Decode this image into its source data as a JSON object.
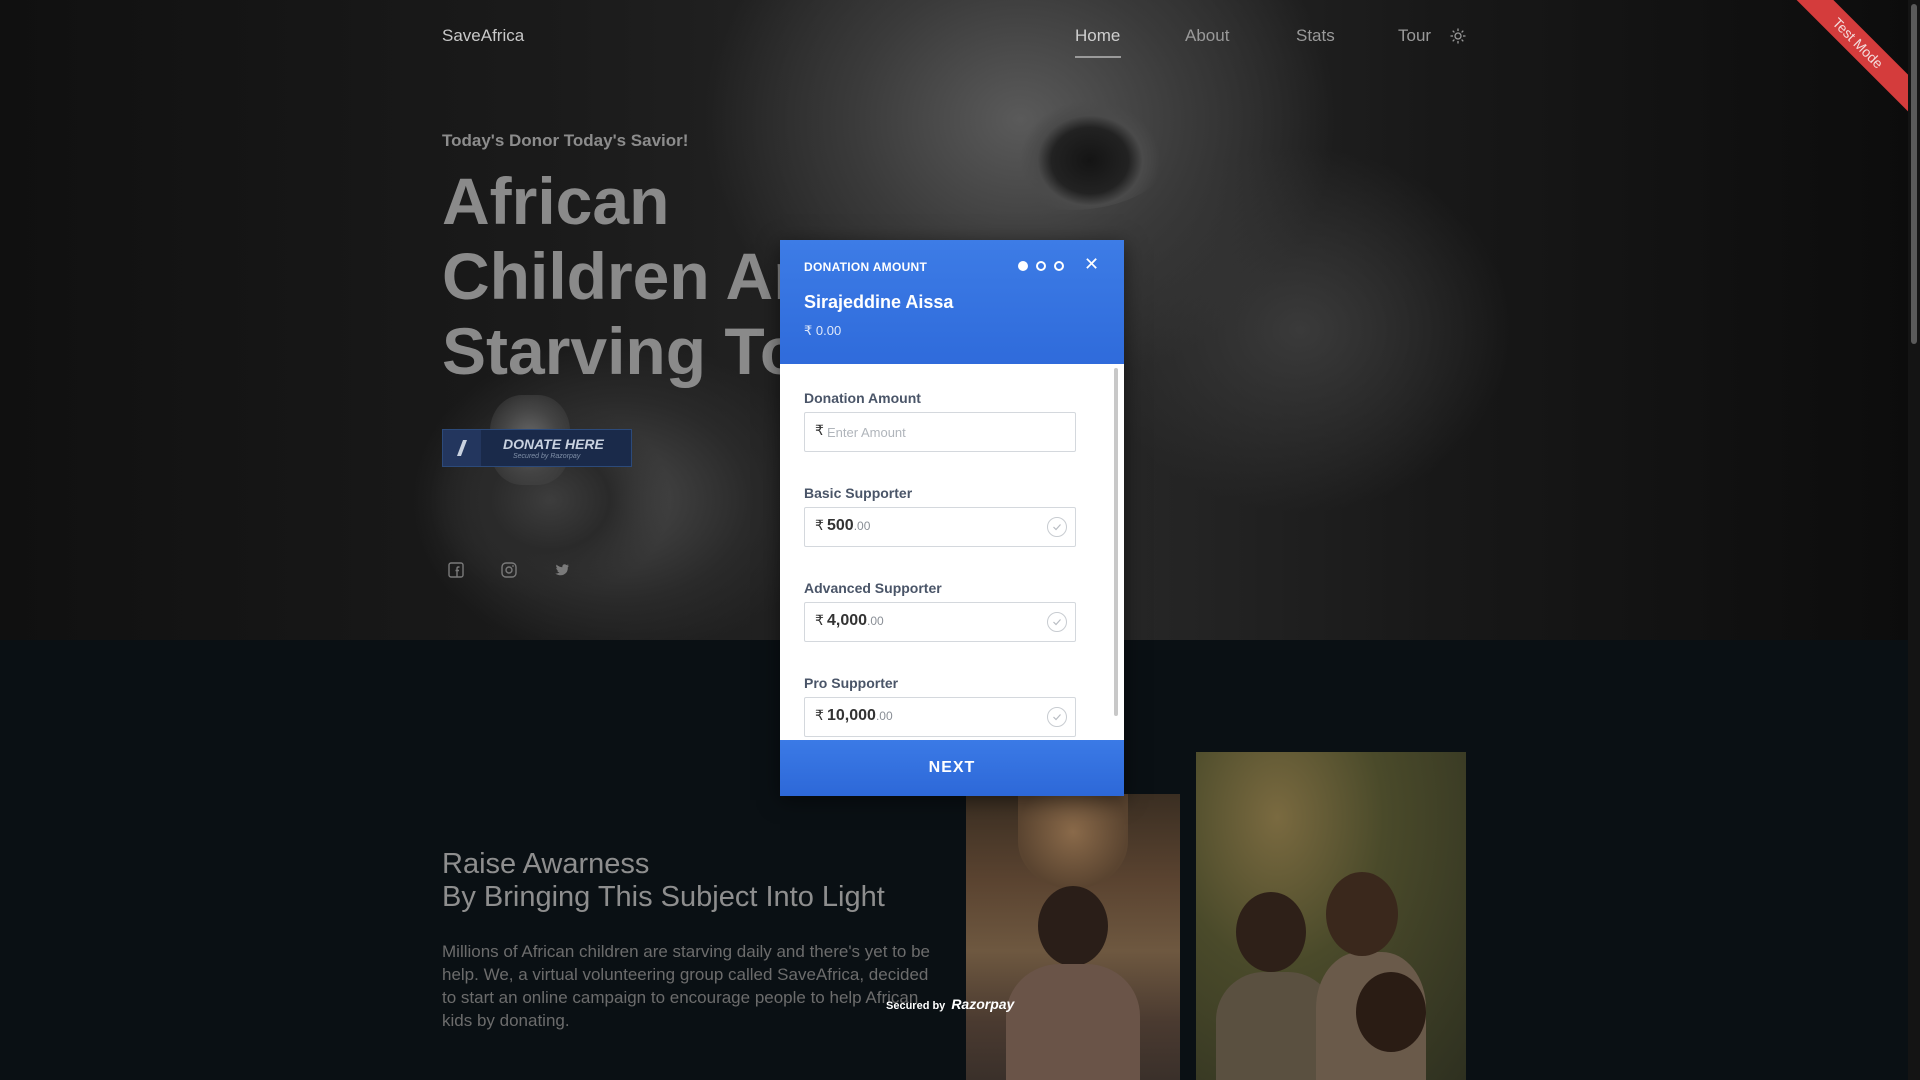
{
  "nav": {
    "brand": "SaveAfrica",
    "items": [
      {
        "label": "Home",
        "active": true
      },
      {
        "label": "About",
        "active": false
      },
      {
        "label": "Stats",
        "active": false
      },
      {
        "label": "Tour",
        "active": false
      }
    ],
    "theme_icon": "sun-icon"
  },
  "hero": {
    "tagline": "Today's Donor Today's Savior!",
    "headline": "African\nChildren Ar\nStarving To",
    "donate_button": {
      "label": "DONATE HERE",
      "sub": "Secured by Razorpay"
    },
    "social_icons": [
      "facebook-icon",
      "instagram-icon",
      "twitter-icon"
    ]
  },
  "ribbon": {
    "label": "Test Mode",
    "color": "#d43c3c"
  },
  "awareness": {
    "title_line1": "Raise Awarness",
    "title_line2": "By Bringing This Subject Into Light",
    "text": "Millions of African children are starving daily and there's yet to be help. We, a virtual volunteering group called SaveAfrica, decided to start an online campaign to encourage people to help African kids by donating."
  },
  "secured": {
    "prefix": "Secured by",
    "brand": "Razorpay"
  },
  "modal": {
    "caption": "DONATION AMOUNT",
    "step_dots": 3,
    "current_step": 1,
    "close_icon": "close-icon",
    "name": "Sirajeddine Aissa",
    "amount": "₹ 0.00",
    "accent_color": "#2f6bdb",
    "currency_symbol": "₹",
    "custom": {
      "label": "Donation Amount",
      "placeholder": "Enter Amount",
      "value": ""
    },
    "options": [
      {
        "label": "Basic Supporter",
        "amount": "500",
        "decimals": ".00"
      },
      {
        "label": "Advanced Supporter",
        "amount": "4,000",
        "decimals": ".00"
      },
      {
        "label": "Pro Supporter",
        "amount": "10,000",
        "decimals": ".00"
      }
    ],
    "next_label": "NEXT"
  }
}
